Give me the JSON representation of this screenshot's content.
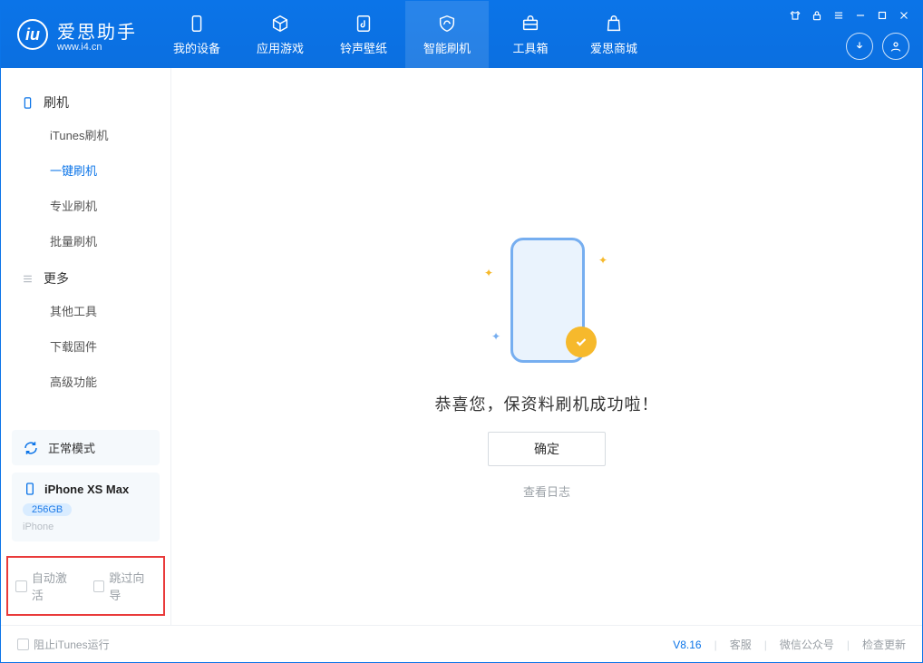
{
  "app": {
    "name": "爱思助手",
    "url": "www.i4.cn"
  },
  "nav": {
    "items": [
      {
        "label": "我的设备"
      },
      {
        "label": "应用游戏"
      },
      {
        "label": "铃声壁纸"
      },
      {
        "label": "智能刷机"
      },
      {
        "label": "工具箱"
      },
      {
        "label": "爱思商城"
      }
    ]
  },
  "sidebar": {
    "section1": {
      "title": "刷机",
      "items": [
        "iTunes刷机",
        "一键刷机",
        "专业刷机",
        "批量刷机"
      ]
    },
    "section2": {
      "title": "更多",
      "items": [
        "其他工具",
        "下载固件",
        "高级功能"
      ]
    }
  },
  "device": {
    "mode": "正常模式",
    "name": "iPhone XS Max",
    "capacity": "256GB",
    "type": "iPhone"
  },
  "options": {
    "auto_activate": "自动激活",
    "skip_guide": "跳过向导"
  },
  "main": {
    "success": "恭喜您，保资料刷机成功啦！",
    "ok": "确定",
    "view_log": "查看日志"
  },
  "footer": {
    "block_itunes": "阻止iTunes运行",
    "version": "V8.16",
    "service": "客服",
    "wechat": "微信公众号",
    "update": "检查更新"
  }
}
